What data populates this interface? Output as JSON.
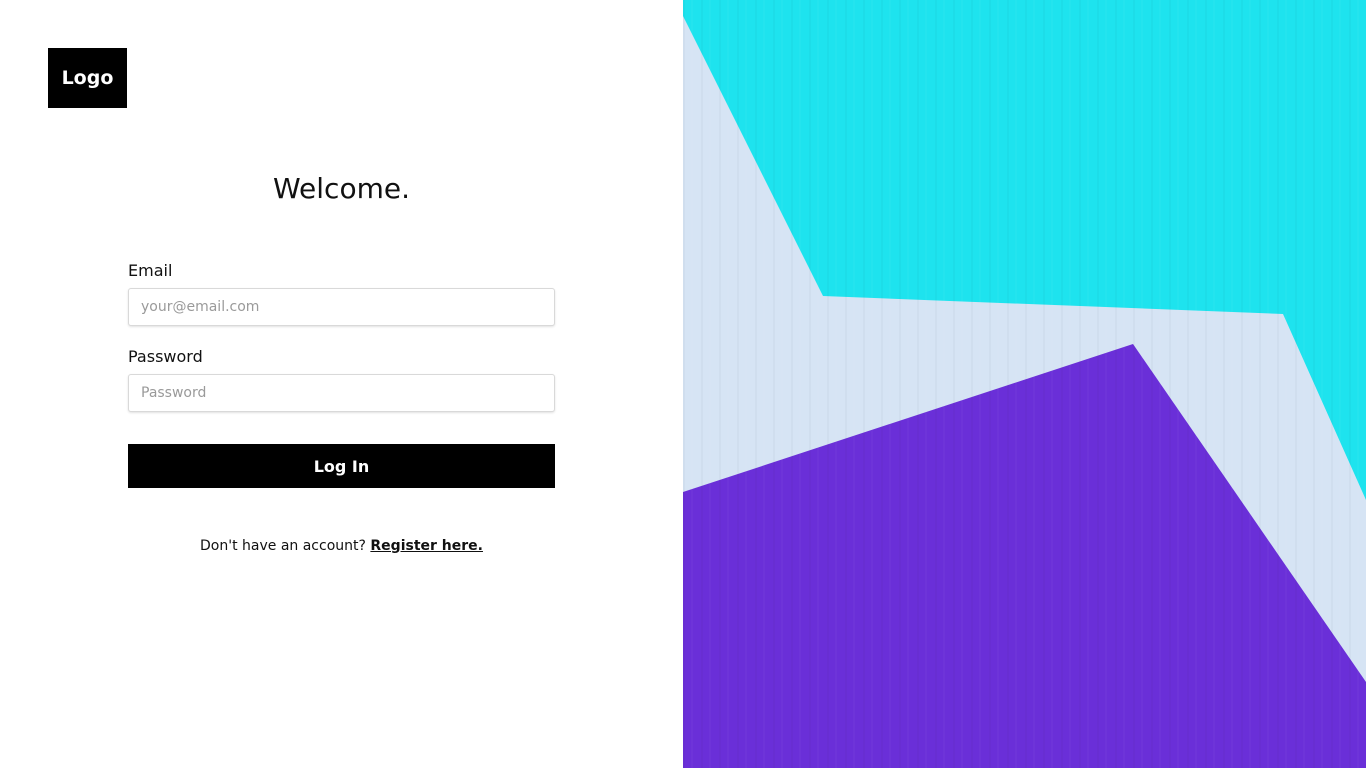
{
  "logo": {
    "label": "Logo"
  },
  "heading": "Welcome.",
  "form": {
    "email": {
      "label": "Email",
      "placeholder": "your@email.com",
      "value": ""
    },
    "password": {
      "label": "Password",
      "placeholder": "Password",
      "value": ""
    },
    "submit_label": "Log In"
  },
  "footer": {
    "prompt": "Don't have an account?",
    "link_label": "Register here."
  },
  "colors": {
    "cyan": "#1ee3ee",
    "purple": "#6a2fd8",
    "pale": "#d6e4f4"
  }
}
